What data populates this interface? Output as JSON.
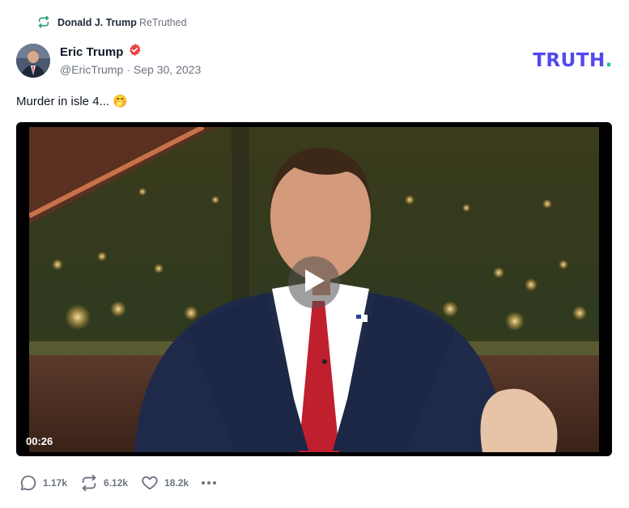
{
  "retruth": {
    "user": "Donald J. Trump",
    "label": "ReTruthed",
    "icon": "retruth-icon",
    "icon_color": "#22a06b"
  },
  "author": {
    "name": "Eric Trump",
    "verified_icon": "verified-badge-icon",
    "verified_color": "#ef4444",
    "handle": "@EricTrump",
    "separator": "·",
    "date": "Sep 30, 2023"
  },
  "brand": {
    "word": "TRUTH",
    "dot": ".",
    "color": "#5448ee",
    "dot_color": "#10c5a5"
  },
  "post": {
    "text": "Murder in isle 4...",
    "emoji": "🤭"
  },
  "video": {
    "duration": "00:26",
    "play_icon": "play-icon"
  },
  "actions": {
    "replies": {
      "icon": "reply-icon",
      "count": "1.17k"
    },
    "retruths": {
      "icon": "retruth-icon",
      "count": "6.12k"
    },
    "likes": {
      "icon": "heart-icon",
      "count": "18.2k"
    },
    "more": {
      "icon": "more-dots-icon"
    }
  }
}
